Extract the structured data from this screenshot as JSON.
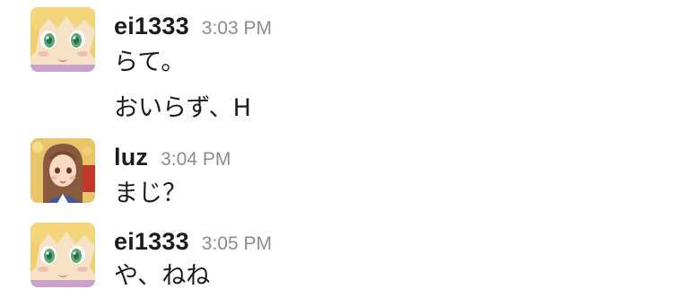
{
  "messages": [
    {
      "user": "ei1333",
      "time": "3:03 PM",
      "avatar_icon": "anime-blonde-girl-avatar",
      "lines": [
        "らて。",
        "おいらず、H"
      ]
    },
    {
      "user": "luz",
      "time": "3:04 PM",
      "avatar_icon": "anime-brown-hair-girl-avatar",
      "lines": [
        "まじ？"
      ]
    },
    {
      "user": "ei1333",
      "time": "3:05 PM",
      "avatar_icon": "anime-blonde-girl-avatar",
      "lines": [
        "や、ねね"
      ]
    }
  ],
  "colors": {
    "username": "#1d1c1d",
    "timestamp": "#8c8c8c",
    "background": "#ffffff"
  }
}
